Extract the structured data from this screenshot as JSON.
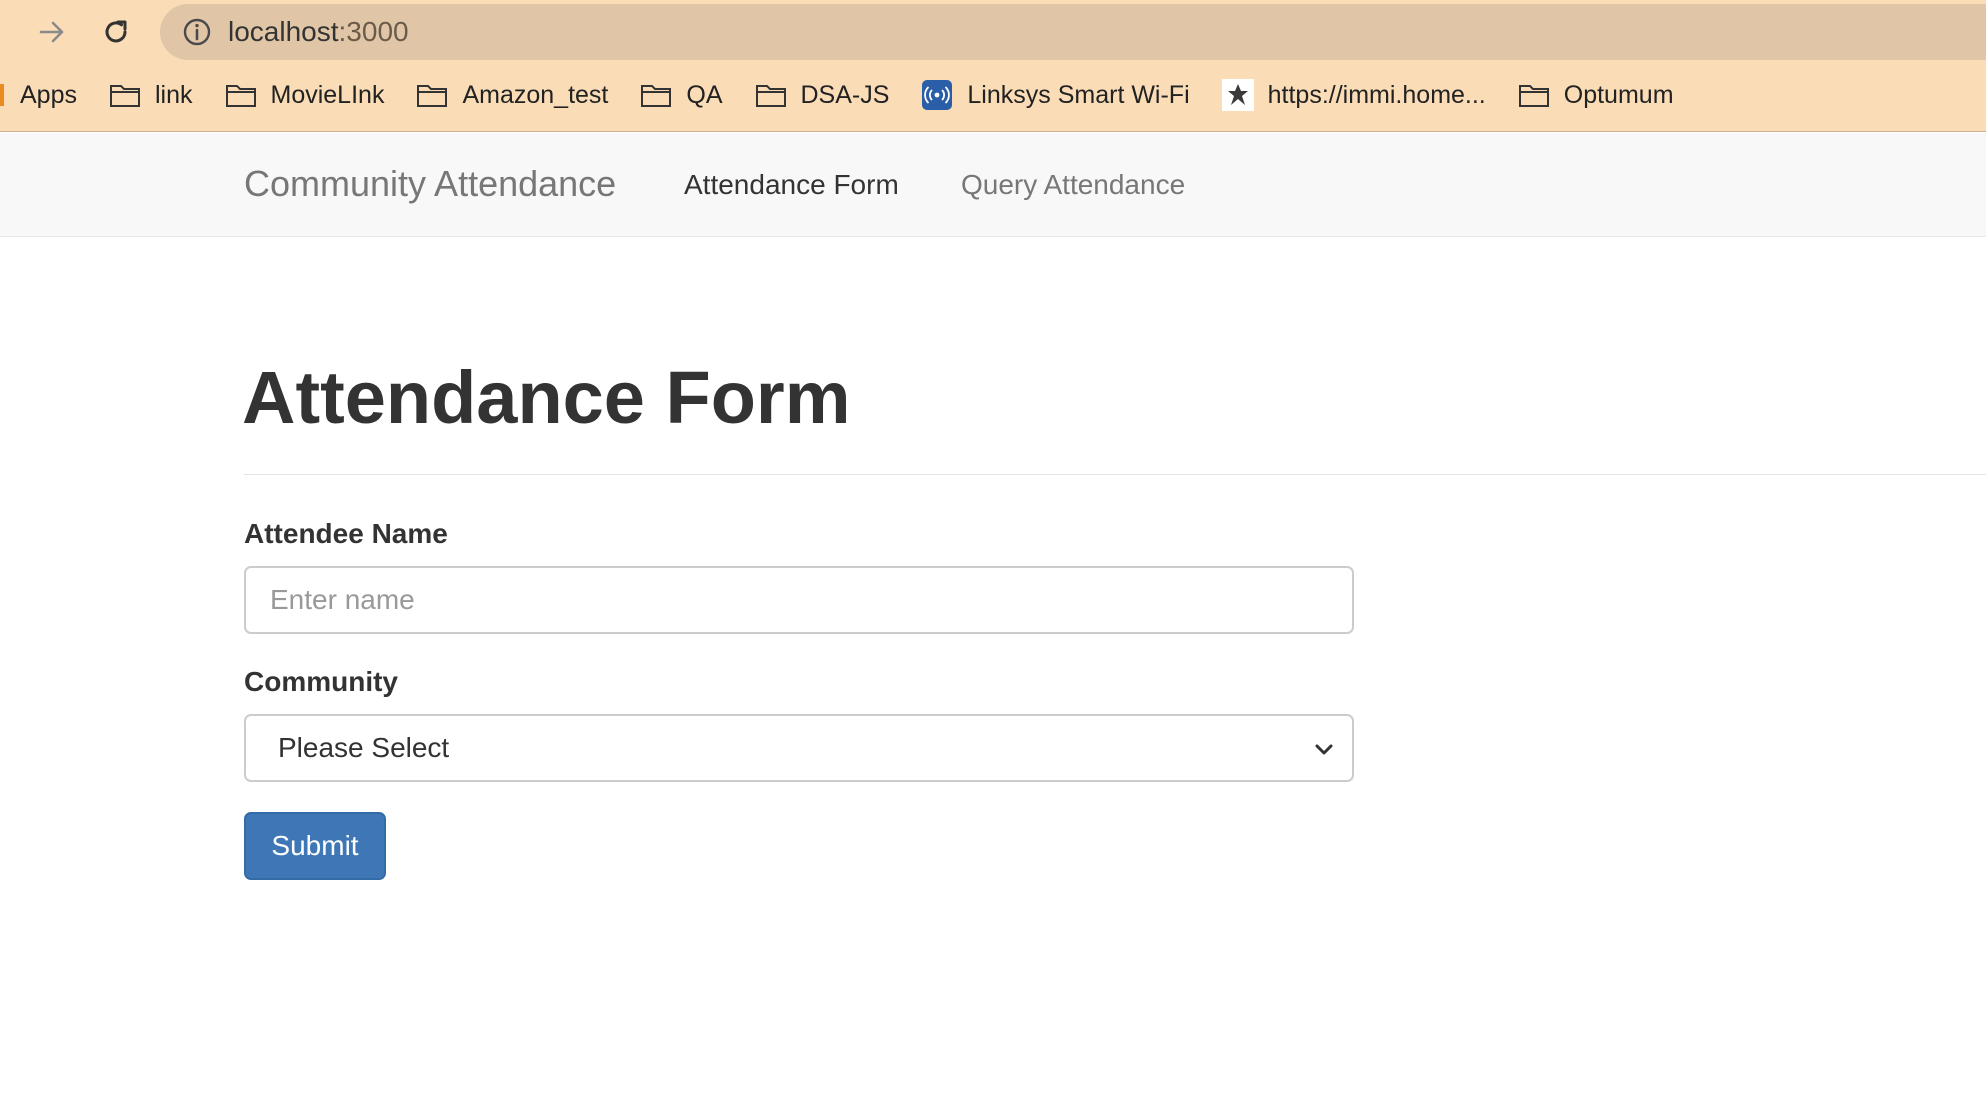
{
  "browser": {
    "url_host": "localhost",
    "url_port": ":3000",
    "bookmarks": [
      {
        "label": "Apps",
        "icon": "apps-icon"
      },
      {
        "label": "link",
        "icon": "folder-icon"
      },
      {
        "label": "MovieLInk",
        "icon": "folder-icon"
      },
      {
        "label": "Amazon_test",
        "icon": "folder-icon"
      },
      {
        "label": "QA",
        "icon": "folder-icon"
      },
      {
        "label": "DSA-JS",
        "icon": "folder-icon"
      },
      {
        "label": "Linksys Smart Wi-Fi",
        "icon": "linksys-icon"
      },
      {
        "label": "https://immi.home...",
        "icon": "crest-icon"
      },
      {
        "label": "Optumum",
        "icon": "folder-icon"
      }
    ]
  },
  "navbar": {
    "brand": "Community Attendance",
    "links": [
      {
        "label": "Attendance Form",
        "active": true
      },
      {
        "label": "Query Attendance",
        "active": false
      }
    ]
  },
  "form": {
    "title": "Attendance Form",
    "name_label": "Attendee Name",
    "name_placeholder": "Enter name",
    "name_value": "",
    "community_label": "Community",
    "community_selected": "Please Select",
    "submit_label": "Submit"
  },
  "colors": {
    "chrome_bg": "#fadcb7",
    "omnibox_bg": "#e0c6a7",
    "navbar_bg": "#f8f8f8",
    "primary_button": "#3f77b6"
  }
}
